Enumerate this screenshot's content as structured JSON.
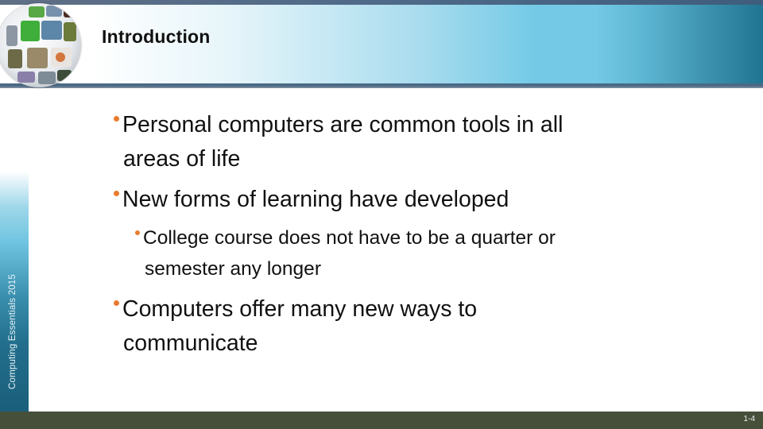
{
  "header": {
    "title": "Introduction",
    "logo": "globe-of-photos-logo"
  },
  "sidebar": {
    "label": "Computing Essentials 2015"
  },
  "content": {
    "bullets": [
      {
        "level": 1,
        "lines": [
          "Personal computers are common tools in all",
          "areas of life"
        ]
      },
      {
        "level": 1,
        "lines": [
          "New forms of learning have developed"
        ]
      },
      {
        "level": 2,
        "lines": [
          "College course does not have to be a quarter or",
          "semester any longer"
        ]
      },
      {
        "level": 1,
        "lines": [
          "Computers offer many new ways to",
          "communicate"
        ]
      }
    ]
  },
  "footer": {
    "page_number": "1-4"
  },
  "colors": {
    "bullet": "#e97b2e",
    "footer": "#464f3a",
    "header_accent": "#74cae6",
    "header_dark": "#1f7592"
  }
}
